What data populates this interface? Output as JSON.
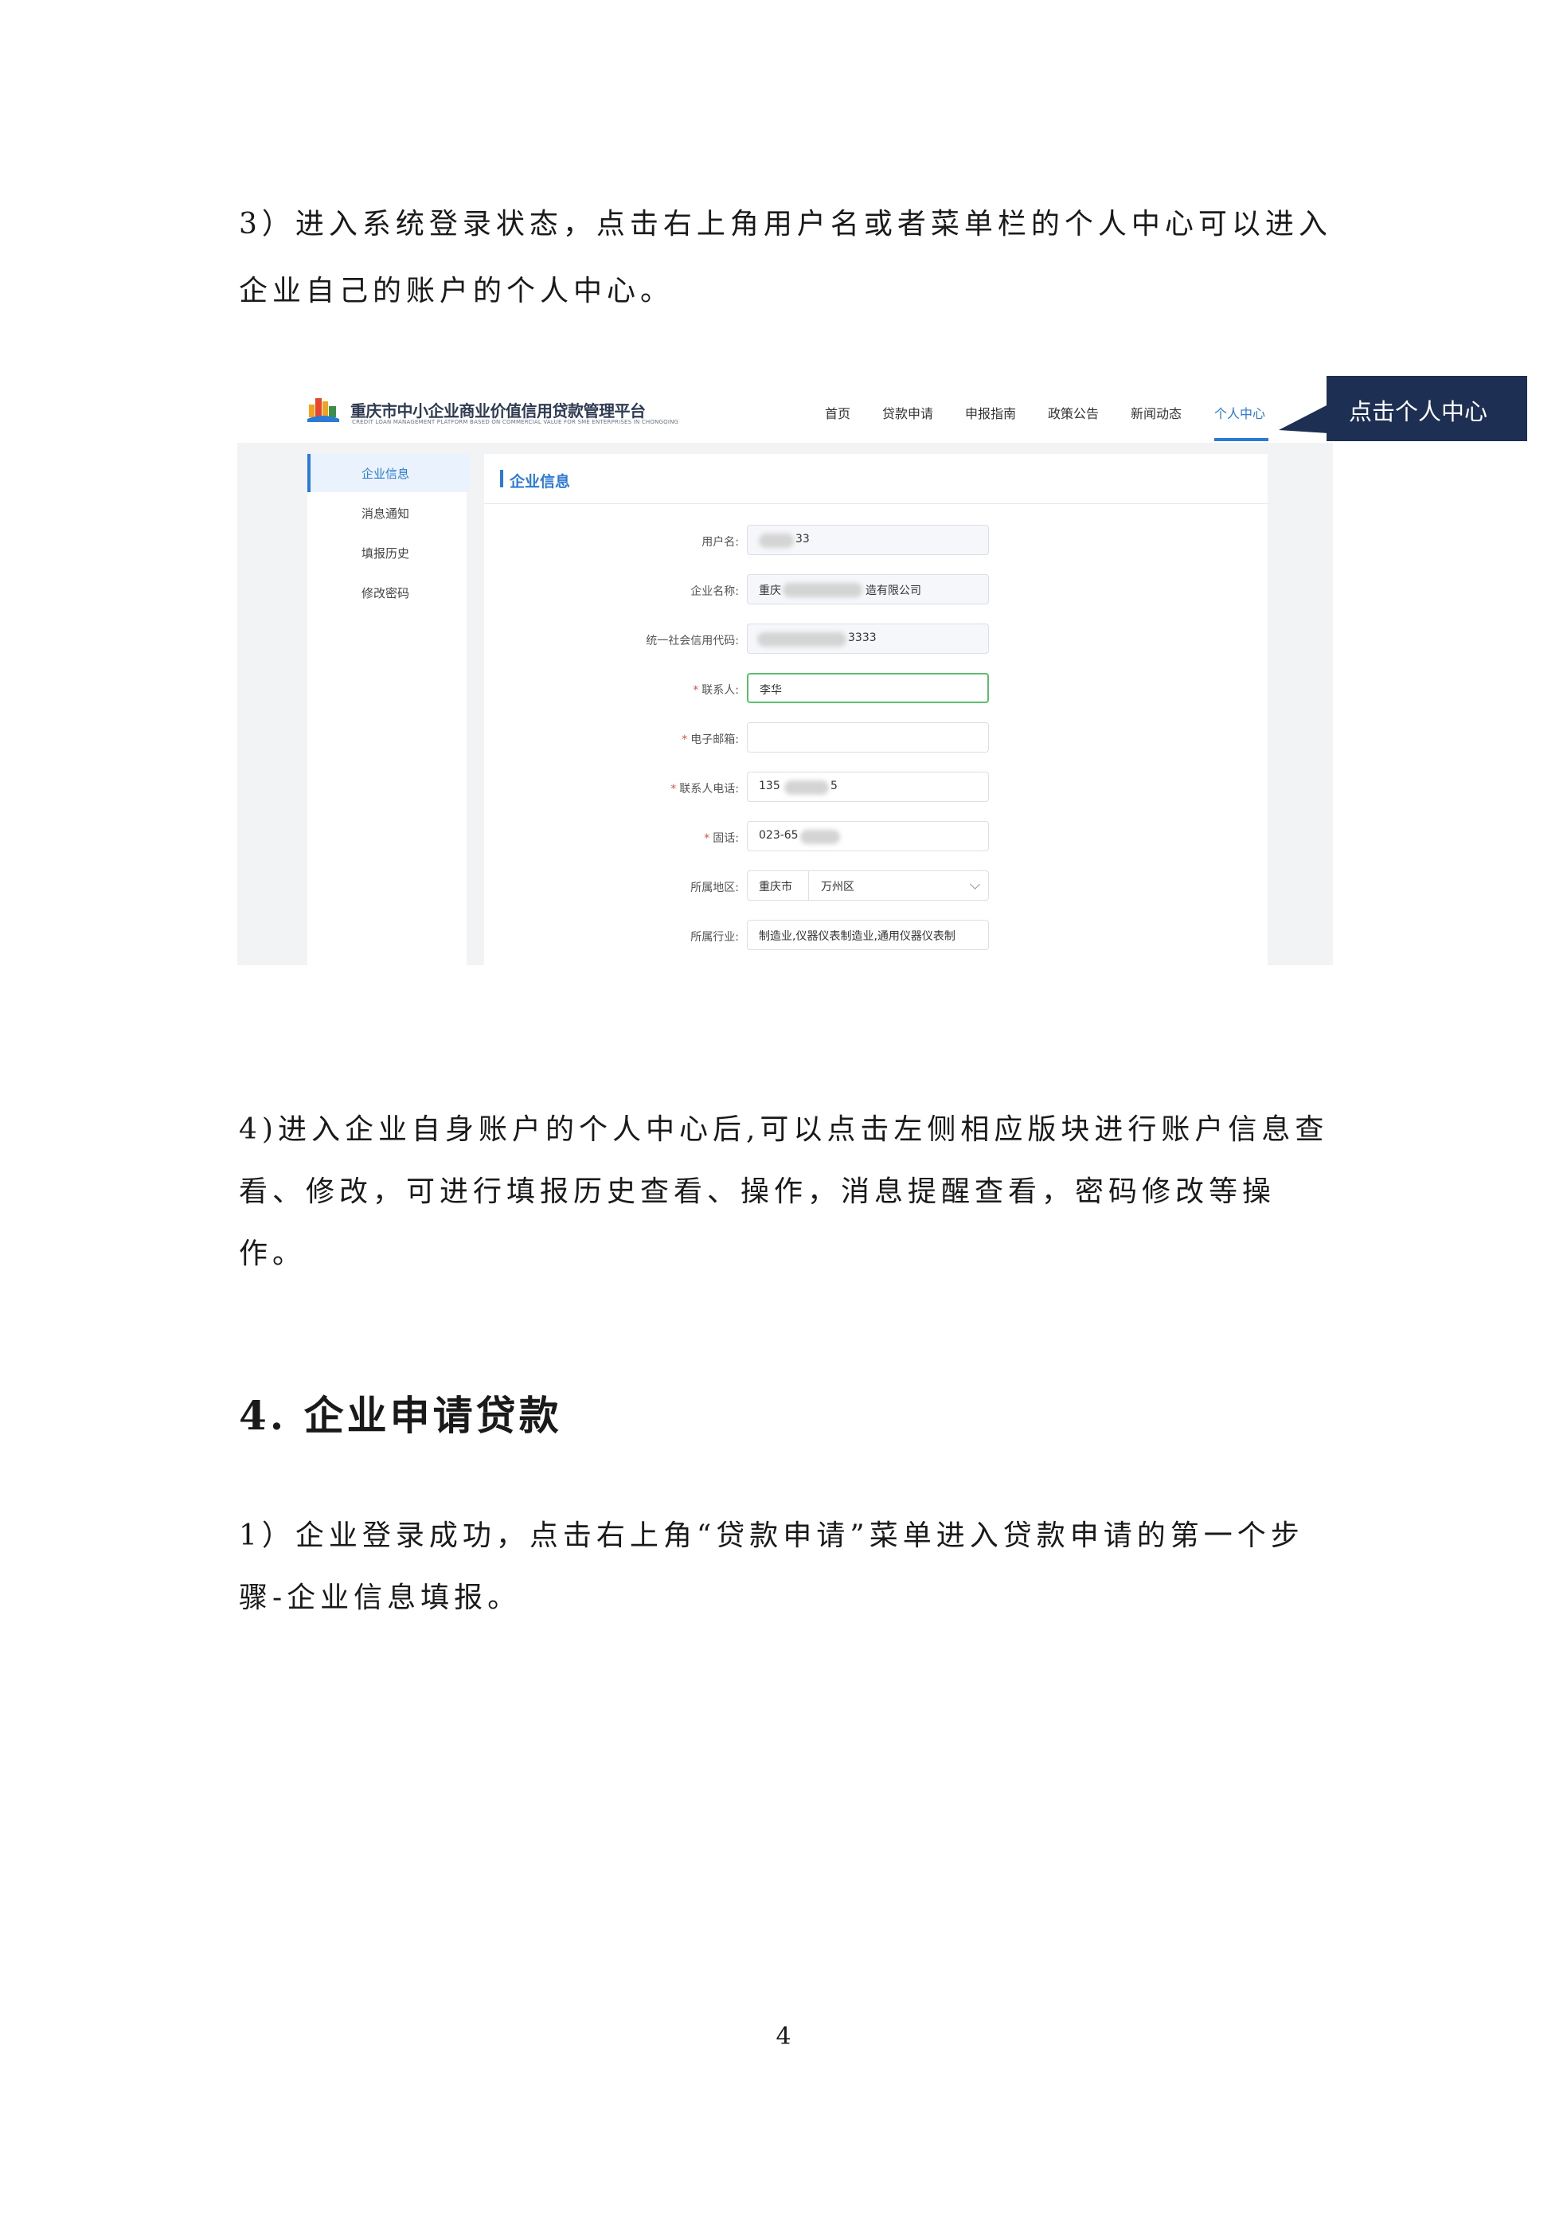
{
  "doc": {
    "para1": "3）进入系统登录状态，点击右上角用户名或者菜单栏的个人中心可以进入企业自己的账户的个人中心。",
    "para2": "4)进入企业自身账户的个人中心后,可以点击左侧相应版块进行账户信息查看、修改，可进行填报历史查看、操作，消息提醒查看，密码修改等操作。",
    "heading": "4.  企业申请贷款",
    "para3": "1）企业登录成功，点击右上角“贷款申请”菜单进入贷款申请的第一个步骤-企业信息填报。",
    "page_number": "4",
    "callout": "点击个人中心"
  },
  "screenshot": {
    "logo_title": "重庆市中小企业商业价值信用贷款管理平台",
    "logo_subtitle": "CREDIT LOAN MANAGEMENT PLATFORM BASED ON COMMERCIAL VALUE FOR SME ENTERPRISES IN CHONGQING",
    "nav": [
      "首页",
      "贷款申请",
      "申报指南",
      "政策公告",
      "新闻动态",
      "个人中心"
    ],
    "active_nav": "个人中心",
    "side_menu": [
      "企业信息",
      "消息通知",
      "填报历史",
      "修改密码"
    ],
    "panel_title": "企业信息",
    "form": {
      "username_label": "用户名:",
      "username_value": "33",
      "company_label": "企业名称:",
      "company_value_prefix": "重庆",
      "company_value_suffix": "造有限公司",
      "credit_code_label": "统一社会信用代码:",
      "credit_code_value": "3333",
      "contact_label": "联系人:",
      "contact_value": "李华",
      "email_label": "电子邮箱:",
      "email_value": "",
      "phone_label": "联系人电话:",
      "phone_value_prefix": "135",
      "phone_value_suffix": "5",
      "tel_label": "固话:",
      "tel_value": "023-65",
      "region_label": "所属地区:",
      "region_city": "重庆市",
      "region_district": "万州区",
      "industry_label": "所属行业:",
      "industry_value": "制造业,仪器仪表制造业,通用仪器仪表制"
    },
    "colors": {
      "accent": "#2a7ad6",
      "callout_bg": "#1e2f54",
      "required": "#e34d4d",
      "focus_border": "#5bbf6b"
    }
  }
}
